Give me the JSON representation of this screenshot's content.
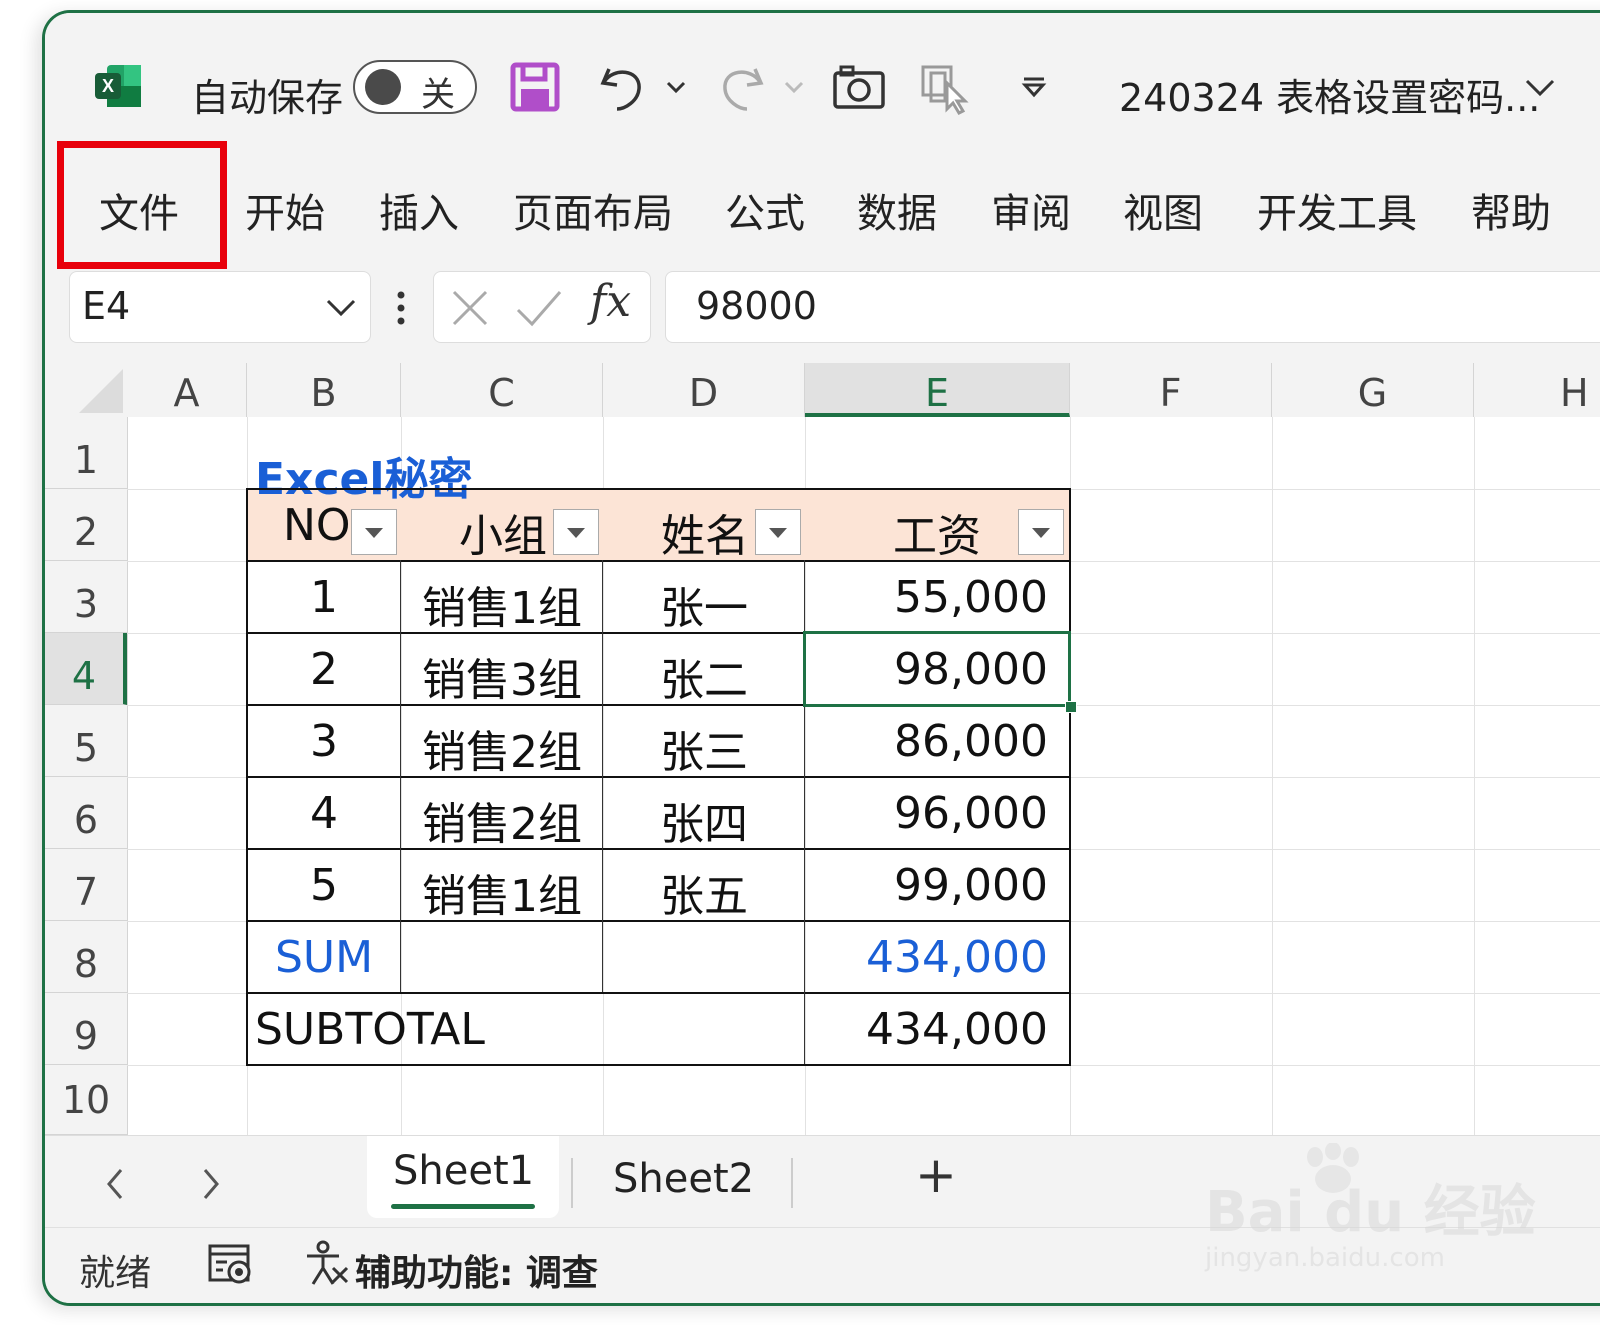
{
  "titlebar": {
    "autosave_label": "自动保存",
    "autosave_state": "关",
    "document_title": "240324 表格设置密码..."
  },
  "ribbon": {
    "tabs": [
      {
        "label": "文件",
        "highlighted": true
      },
      {
        "label": "开始"
      },
      {
        "label": "插入"
      },
      {
        "label": "页面布局"
      },
      {
        "label": "公式"
      },
      {
        "label": "数据"
      },
      {
        "label": "审阅"
      },
      {
        "label": "视图"
      },
      {
        "label": "开发工具"
      },
      {
        "label": "帮助"
      }
    ]
  },
  "formula_bar": {
    "name_box": "E4",
    "fx_label": "fx",
    "formula_value": "98000"
  },
  "grid": {
    "columns": [
      "A",
      "B",
      "C",
      "D",
      "E",
      "F",
      "G",
      "H"
    ],
    "rows": [
      "1",
      "2",
      "3",
      "4",
      "5",
      "6",
      "7",
      "8",
      "9",
      "10"
    ],
    "selected_column": "E",
    "selected_row": "4",
    "title_cell": "Excel秘密",
    "headers": [
      "NO",
      "小组",
      "姓名",
      "工资"
    ],
    "data_rows": [
      [
        "1",
        "销售1组",
        "张一",
        "55,000"
      ],
      [
        "2",
        "销售3组",
        "张二",
        "98,000"
      ],
      [
        "3",
        "销售2组",
        "张三",
        "86,000"
      ],
      [
        "4",
        "销售2组",
        "张四",
        "96,000"
      ],
      [
        "5",
        "销售1组",
        "张五",
        "99,000"
      ]
    ],
    "sum_label": "SUM",
    "sum_value": "434,000",
    "subtotal_label": "SUBTOTAL",
    "subtotal_value": "434,000"
  },
  "sheets": {
    "tabs": [
      "Sheet1",
      "Sheet2"
    ],
    "active": "Sheet1",
    "add_label": "+"
  },
  "status": {
    "ready": "就绪",
    "accessibility": "辅助功能: 调查"
  },
  "watermark": {
    "brand": "Bai du 经验",
    "url": "jingyan.baidu.com"
  },
  "colors": {
    "excel_green": "#1e7145",
    "header_fill": "#fce4d6",
    "link_blue": "#1a5fd6",
    "highlight_red": "#e8000b"
  }
}
